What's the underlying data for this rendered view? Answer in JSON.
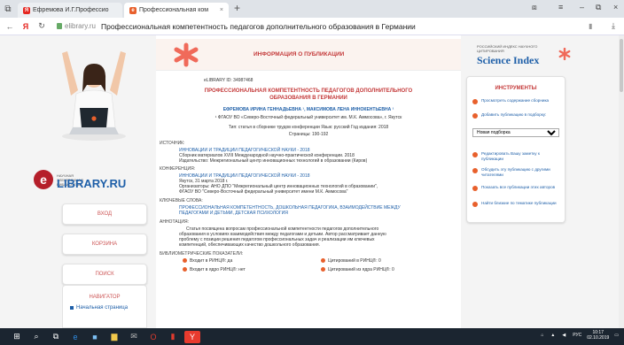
{
  "browser": {
    "tabs": [
      {
        "label": "Ефремова И.Г.Профессио",
        "icon": "yandex-icon"
      },
      {
        "label": "Профессиональная ком",
        "icon": "elibrary-icon"
      }
    ],
    "address_domain": "elibrary.ru",
    "address_title": "Профессиональная компетентность педагогов дополнительного образования в Германии"
  },
  "left": {
    "logo_small": "НАУЧНАЯ ЭЛЕКТРОННАЯ БИБЛИОТЕКА",
    "logo_main": "LIBRARY.RU",
    "buttons": [
      "ВХОД",
      "КОРЗИНА",
      "ПОИСК"
    ],
    "navigator": {
      "title": "НАВИГАТОР",
      "items": [
        "Начальная страница"
      ]
    }
  },
  "center": {
    "banner_title": "ИНФОРМАЦИЯ О ПУБЛИКАЦИИ",
    "elib_id": "eLIBRARY ID: 34987468",
    "title_line1": "ПРОФЕССИОНАЛЬНАЯ КОМПЕТЕНТНОСТЬ ПЕДАГОГОВ ДОПОЛНИТЕЛЬНОГО",
    "title_line2": "ОБРАЗОВАНИЯ В ГЕРМАНИИ",
    "authors": "ЕФРЕМОВА ИРИНА ГЕННАДЬЕВНА ¹, МАКСИМОВА ЛЕНА ИННОКЕНТЬЕВНА ¹",
    "affiliation": "¹ ФГАОУ ВО «Северо-Восточный федеральный университет им. М.К. Аммосова», г. Якутск",
    "type_line": "Тип: статья в сборнике трудов конференции     Язык: русский     Год издания: 2018",
    "pages": "Страницы: 190-192",
    "source_h": "ИСТОЧНИК:",
    "source_1": "ИННОВАЦИИ И ТРАДИЦИИ ПЕДАГОГИЧЕСКОЙ НАУКИ - 2018",
    "source_2": "Сборник материалов XVIII Международной научно-практической конференции. 2018",
    "source_3": "Издательство: Межрегиональный центр инновационных технологий в образовании (Киров)",
    "conf_h": "КОНФЕРЕНЦИЯ:",
    "conf_1": "ИННОВАЦИИ И ТРАДИЦИИ ПЕДАГОГИЧЕСКОЙ НАУКИ - 2018",
    "conf_2": "Якутск, 31 марта 2018 г.",
    "conf_3": "Организаторы: АНО ДПО \"Межрегиональный центр инновационных технологий в образовании\",",
    "conf_4": "ФГАОУ ВО \"Северо-Восточный федеральный университет имени М.К. Аммосова\"",
    "kw_h": "КЛЮЧЕВЫЕ СЛОВА:",
    "kw_1": "ПРОФЕССИОНАЛЬНАЯ КОМПЕТЕНТНОСТЬ, ДОШКОЛЬНАЯ ПЕДАГОГИКА, ВЗАИМОДЕЙСТВИЕ МЕЖДУ",
    "kw_2": "ПЕДАГОГАМИ И ДЕТЬМИ, ДЕТСКАЯ ПСИХОЛОГИЯ",
    "ann_h": "АННОТАЦИЯ:",
    "ann_1": "Статья посвящена вопросам профессиональной компетентности педагогов дополнительного",
    "ann_2": "образования в условиях взаимодействия между педагогами и детьми. Автор рассматривает данную",
    "ann_3": "проблему с позиции решения педагогом профессиональных задач и реализации им ключевых",
    "ann_4": "компетенций, обеспечивающих качество дошкольного образования.",
    "bib_h": "БИБЛИОМЕТРИЧЕСКИЕ ПОКАЗАТЕЛИ:",
    "bib_1": "Входит в РИНЦ®: да",
    "bib_2": "Цитирований в РИНЦ®: 0",
    "bib_3": "Входит в ядро РИНЦ®: нет",
    "bib_4": "Цитирований из ядра РИНЦ®: 0"
  },
  "right": {
    "sci_small": "РОССИЙСКИЙ ИНДЕКС НАУЧНОГО ЦИТИРОВАНИЯ",
    "sci_big": "Science Index",
    "tools_title": "ИНСТРУМЕНТЫ",
    "tools": [
      "Просмотреть содержание сборника",
      "Добавить публикацию в подборку:",
      "Редактировать Вашу заметку к публикации",
      "Обсудить эту публикацию с другими читателями",
      "Показать все публикации этих авторов",
      "Найти близкие по тематике публикации"
    ],
    "select_value": "Новая подборка"
  },
  "taskbar": {
    "lang": "РУС",
    "time": "10:17",
    "date": "02.10.2019"
  }
}
